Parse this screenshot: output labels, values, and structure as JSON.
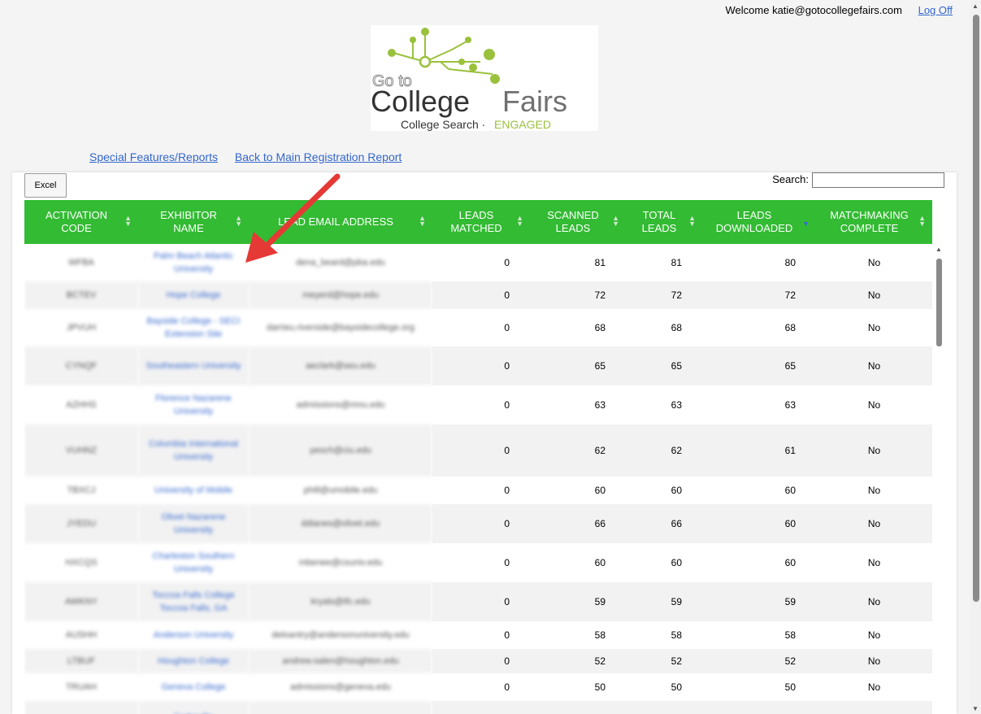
{
  "header": {
    "welcome_text": "Welcome katie@gotocollegefairs.com",
    "logoff_label": "Log Off"
  },
  "logo": {
    "line1": "Go to",
    "line2a": "College",
    "line2b": "Fairs",
    "tagline_a": "College Search · ",
    "tagline_b": "ENGAGED",
    "accent": "#9ac13c",
    "gray": "#707070"
  },
  "nav": {
    "special_features": "Special Features/Reports",
    "back_main": "Back to Main Registration Report"
  },
  "toolbar": {
    "excel_label": "Excel",
    "search_label": "Search:",
    "search_value": ""
  },
  "colors": {
    "header_green": "#33bb33",
    "link_blue": "#3366cc",
    "arrow_red": "#e53935"
  },
  "table": {
    "columns": [
      {
        "line1": "ACTIVATION",
        "line2": "CODE"
      },
      {
        "line1": "EXHIBITOR",
        "line2": "NAME"
      },
      {
        "line1": "LEAD EMAIL ADDRESS",
        "line2": ""
      },
      {
        "line1": "LEADS",
        "line2": "MATCHED"
      },
      {
        "line1": "SCANNED",
        "line2": "LEADS"
      },
      {
        "line1": "TOTAL",
        "line2": "LEADS"
      },
      {
        "line1": "LEADS",
        "line2": "DOWNLOADED"
      },
      {
        "line1": "MATCHMAKING",
        "line2": "COMPLETE"
      }
    ],
    "rows": [
      {
        "code": "WFBA",
        "name": "Palm Beach Atlantic University",
        "email": "dena_beard@pba.edu",
        "matched": "0",
        "scanned": "81",
        "total": "81",
        "downloaded": "80",
        "complete": "No"
      },
      {
        "code": "BCTEV",
        "name": "Hope College",
        "email": "meyerd@hope.edu",
        "matched": "0",
        "scanned": "72",
        "total": "72",
        "downloaded": "72",
        "complete": "No"
      },
      {
        "code": "JPVUH",
        "name": "Bayside College - SECI Extension Site",
        "email": "darrieu.riverside@baysidecollege.org",
        "matched": "0",
        "scanned": "68",
        "total": "68",
        "downloaded": "68",
        "complete": "No"
      },
      {
        "code": "CYNQF",
        "name": "Southeastern University",
        "email": "aeclark@seu.edu",
        "matched": "0",
        "scanned": "65",
        "total": "65",
        "downloaded": "65",
        "complete": "No"
      },
      {
        "code": "AZHHS",
        "name": "Florence Nazarene University",
        "email": "admissions@mnu.edu",
        "matched": "0",
        "scanned": "63",
        "total": "63",
        "downloaded": "63",
        "complete": "No"
      },
      {
        "code": "VUHNZ",
        "name": "Columbia International University",
        "email": "yeoch@ciu.edu",
        "matched": "0",
        "scanned": "62",
        "total": "62",
        "downloaded": "61",
        "complete": "No"
      },
      {
        "code": "TBXCJ",
        "name": "University of Mobile",
        "email": "phill@umobile.edu",
        "matched": "0",
        "scanned": "60",
        "total": "60",
        "downloaded": "60",
        "complete": "No"
      },
      {
        "code": "JYEDU",
        "name": "Olivet Nazarene University",
        "email": "ddianes@olivet.edu",
        "matched": "0",
        "scanned": "66",
        "total": "66",
        "downloaded": "60",
        "complete": "No"
      },
      {
        "code": "HXCQS",
        "name": "Charleston Southern University",
        "email": "mbenee@csuniv.edu",
        "matched": "0",
        "scanned": "60",
        "total": "60",
        "downloaded": "60",
        "complete": "No"
      },
      {
        "code": "AWKNY",
        "name": "Toccoa Falls College Toccoa Falls, GA",
        "email": "kryals@tfc.edu",
        "matched": "0",
        "scanned": "59",
        "total": "59",
        "downloaded": "59",
        "complete": "No"
      },
      {
        "code": "AUSHH",
        "name": "Anderson University",
        "email": "deloantry@andersonuniversity.edu",
        "matched": "0",
        "scanned": "58",
        "total": "58",
        "downloaded": "58",
        "complete": "No"
      },
      {
        "code": "LTBUF",
        "name": "Houghton College",
        "email": "andrew.salen@houghton.edu",
        "matched": "0",
        "scanned": "52",
        "total": "52",
        "downloaded": "52",
        "complete": "No"
      },
      {
        "code": "TRUAH",
        "name": "Geneva College",
        "email": "admissions@geneva.edu",
        "matched": "0",
        "scanned": "50",
        "total": "50",
        "downloaded": "50",
        "complete": "No"
      },
      {
        "code": "",
        "name": "Cedarville",
        "email": "",
        "matched": "",
        "scanned": "",
        "total": "",
        "downloaded": "",
        "complete": ""
      }
    ]
  }
}
